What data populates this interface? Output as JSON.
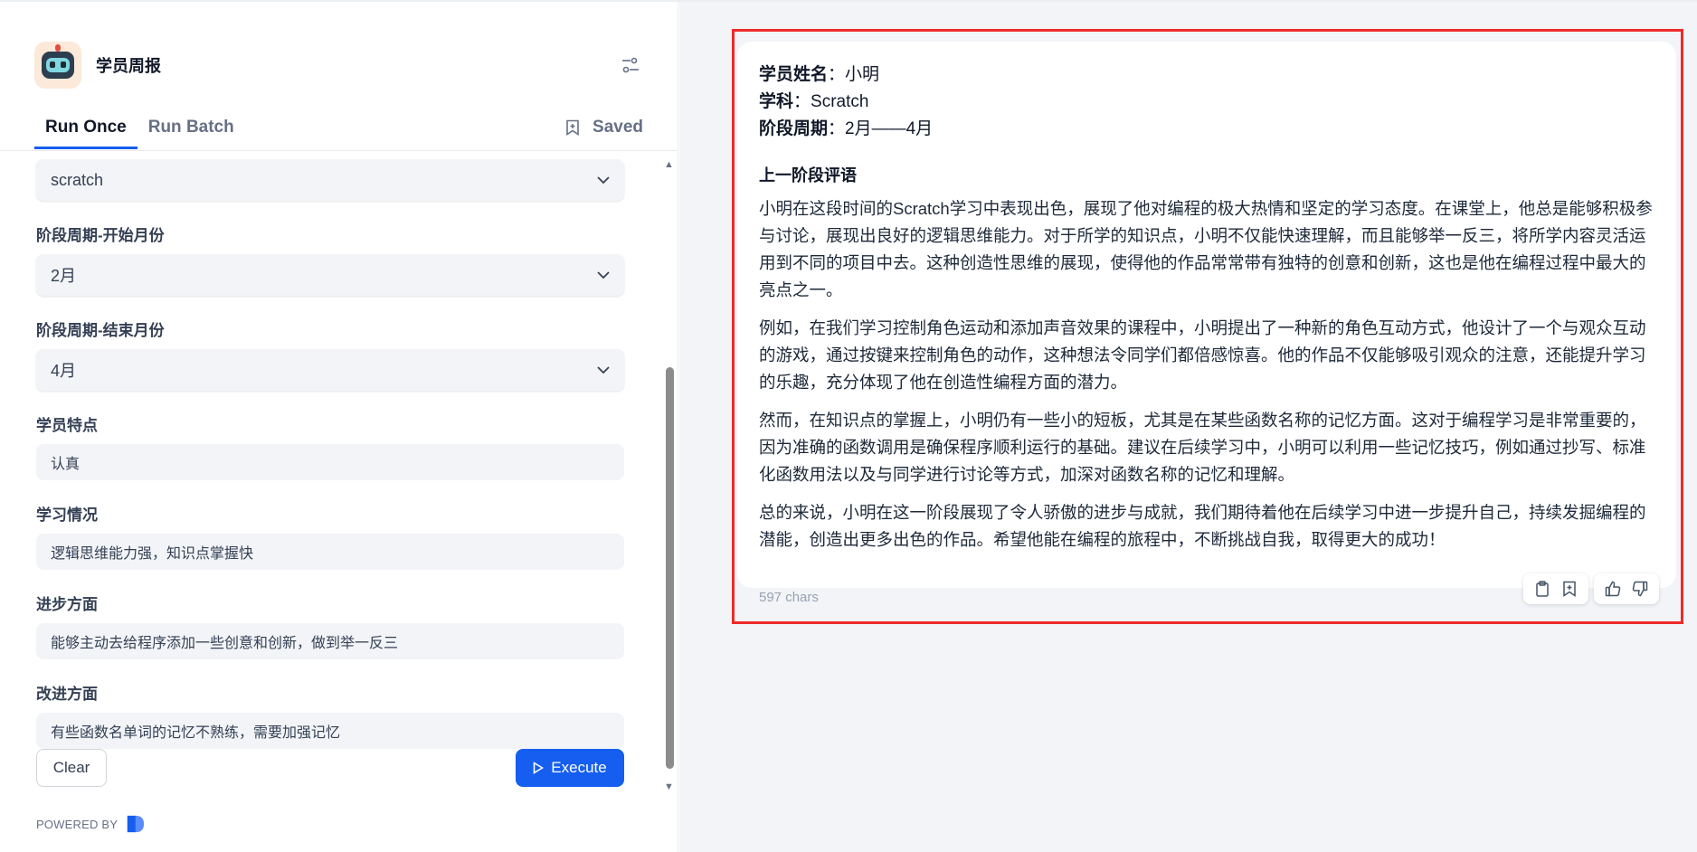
{
  "header": {
    "title": "学员周报"
  },
  "tabs": [
    {
      "label": "Run Once",
      "active": true
    },
    {
      "label": "Run Batch",
      "active": false
    }
  ],
  "saved_label": "Saved",
  "form": {
    "subject_select": {
      "value": "scratch"
    },
    "start_month": {
      "label": "阶段周期-开始月份",
      "value": "2月"
    },
    "end_month": {
      "label": "阶段周期-结束月份",
      "value": "4月"
    },
    "trait": {
      "label": "学员特点",
      "value": "认真"
    },
    "learning": {
      "label": "学习情况",
      "value": "逻辑思维能力强，知识点掌握快"
    },
    "progress": {
      "label": "进步方面",
      "value": "能够主动去给程序添加一些创意和创新，做到举一反三"
    },
    "improve": {
      "label": "改进方面",
      "value": "有些函数名单词的记忆不熟练，需要加强记忆"
    }
  },
  "actions": {
    "clear_label": "Clear",
    "execute_label": "Execute"
  },
  "powered_by": "POWERED BY",
  "result": {
    "name_label": "学员姓名",
    "name_value": "：小明",
    "subject_label": "学科",
    "subject_value": "：Scratch",
    "period_label": "阶段周期",
    "period_value": "：2月——4月",
    "section_title": "上一阶段评语",
    "paragraphs": [
      "小明在这段时间的Scratch学习中表现出色，展现了他对编程的极大热情和坚定的学习态度。在课堂上，他总是能够积极参与讨论，展现出良好的逻辑思维能力。对于所学的知识点，小明不仅能快速理解，而且能够举一反三，将所学内容灵活运用到不同的项目中去。这种创造性思维的展现，使得他的作品常常带有独特的创意和创新，这也是他在编程过程中最大的亮点之一。",
      "例如，在我们学习控制角色运动和添加声音效果的课程中，小明提出了一种新的角色互动方式，他设计了一个与观众互动的游戏，通过按键来控制角色的动作，这种想法令同学们都倍感惊喜。他的作品不仅能够吸引观众的注意，还能提升学习的乐趣，充分体现了他在创造性编程方面的潜力。",
      "然而，在知识点的掌握上，小明仍有一些小的短板，尤其是在某些函数名称的记忆方面。这对于编程学习是非常重要的，因为准确的函数调用是确保程序顺利运行的基础。建议在后续学习中，小明可以利用一些记忆技巧，例如通过抄写、标准化函数用法以及与同学进行讨论等方式，加深对函数名称的记忆和理解。",
      "总的来说，小明在这一阶段展现了令人骄傲的进步与成就，我们期待着他在后续学习中进一步提升自己，持续发掘编程的潜能，创造出更多出色的作品。希望他能在编程的旅程中，不断挑战自我，取得更大的成功！"
    ],
    "char_count": "597 chars"
  },
  "colors": {
    "accent": "#155eef",
    "highlight_border": "#ee2a2a"
  },
  "icons": [
    "robot-app-icon",
    "settings-sliders-icon",
    "bookmark-icon",
    "chevron-down-icon",
    "play-icon",
    "clipboard-icon",
    "bookmark-add-icon",
    "thumbs-up-icon",
    "thumbs-down-icon"
  ]
}
